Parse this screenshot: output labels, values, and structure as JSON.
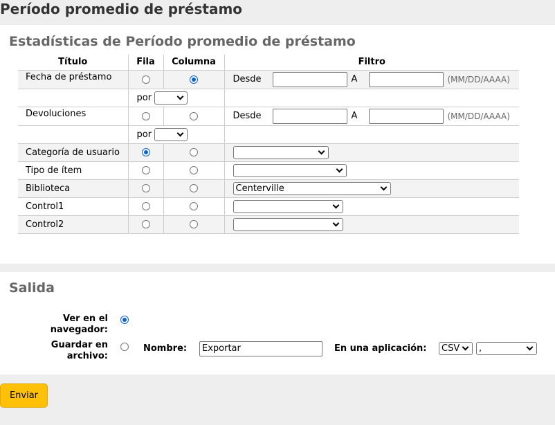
{
  "page_title": "Período promedio de préstamo",
  "stats": {
    "title": "Estadísticas de Período promedio de préstamo",
    "headers": {
      "titulo": "Título",
      "fila": "Fila",
      "columna": "Columna",
      "filtro": "Filtro"
    },
    "rows": {
      "fecha": {
        "label": "Fecha de préstamo",
        "fila": false,
        "columna": true,
        "desde": "Desde",
        "a": "A",
        "date_hint": "(MM/DD/AAAA)",
        "por": "por",
        "por_value": ""
      },
      "devoluciones": {
        "label": "Devoluciones",
        "fila": false,
        "columna": false,
        "desde": "Desde",
        "a": "A",
        "date_hint": "(MM/DD/AAAA)",
        "por": "por",
        "por_value": ""
      },
      "categoria": {
        "label": "Categoría de usuario",
        "fila": true,
        "columna": false,
        "value": ""
      },
      "tipo": {
        "label": "Tipo de ítem",
        "fila": false,
        "columna": false,
        "value": ""
      },
      "biblioteca": {
        "label": "Biblioteca",
        "fila": false,
        "columna": false,
        "value": "Centerville"
      },
      "control1": {
        "label": "Control1",
        "fila": false,
        "columna": false,
        "value": ""
      },
      "control2": {
        "label": "Control2",
        "fila": false,
        "columna": false,
        "value": ""
      }
    }
  },
  "output": {
    "title": "Salida",
    "browser_label": "Ver en el navegador:",
    "browser_selected": true,
    "file_label": "Guardar en archivo:",
    "file_selected": false,
    "name_label": "Nombre:",
    "name_value": "Exportar",
    "app_label": "En una aplicación:",
    "format_value": "CSV",
    "separator_value": ","
  },
  "submit_label": "Enviar",
  "colors": {
    "accent": "#0b63ce",
    "submit": "#ffc107"
  }
}
